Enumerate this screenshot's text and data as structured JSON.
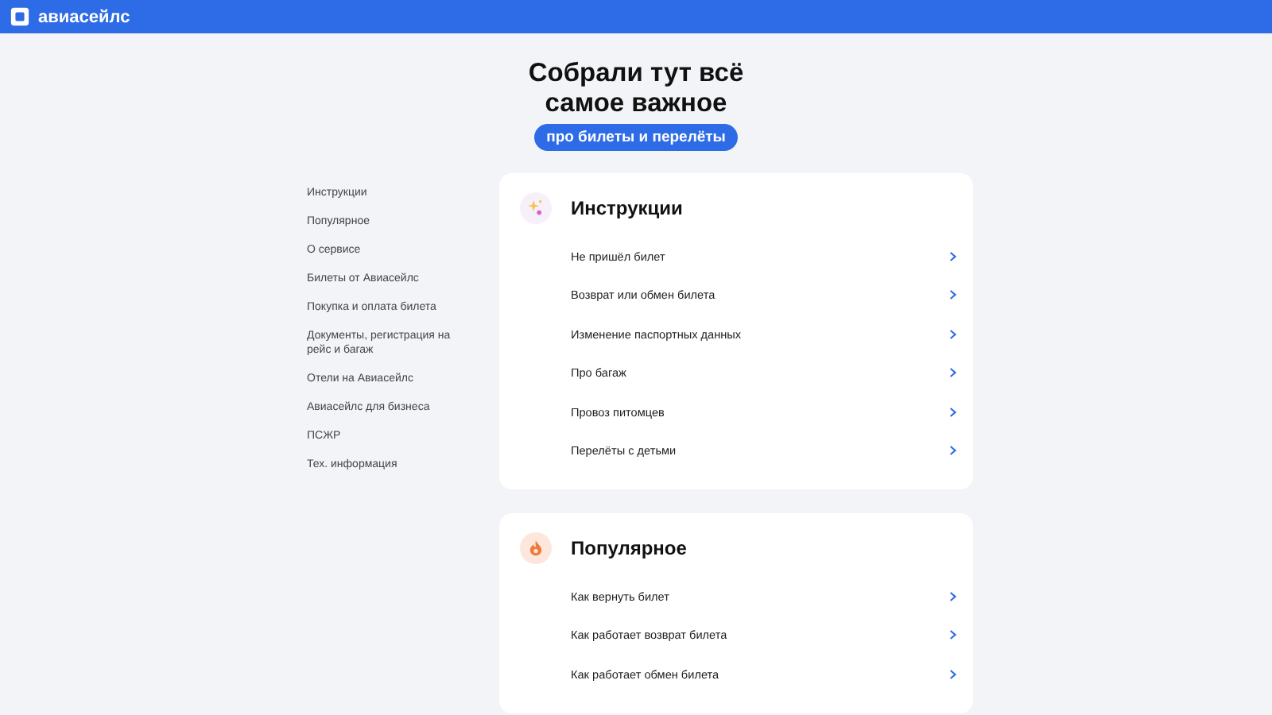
{
  "header": {
    "logo_text": "авиасейлс"
  },
  "hero": {
    "title_lines": [
      "Собрали тут всё",
      "самое важное"
    ],
    "pill": "про билеты и перелёты"
  },
  "sidebar": {
    "items": [
      "Инструкции",
      "Популярное",
      "О сервисе",
      "Билеты от Авиасейлс",
      "Покупка и оплата билета",
      "Документы, регистрация на рейс и багаж",
      "Отели на Авиасейлс",
      "Авиасейлс для бизнеса",
      "ПСЖР",
      "Тех. информация"
    ]
  },
  "sections": [
    {
      "kind": "sparkle",
      "title": "Инструкции",
      "links": [
        "Не пришёл билет",
        "Возврат или обмен билета",
        "Изменение паспортных данных",
        "Про багаж",
        "Провоз питомцев",
        "Перелёты с детьми"
      ]
    },
    {
      "kind": "fire",
      "title": "Популярное",
      "links": [
        "Как вернуть билет",
        "Как работает возврат билета",
        "Как работает обмен билета"
      ]
    }
  ]
}
